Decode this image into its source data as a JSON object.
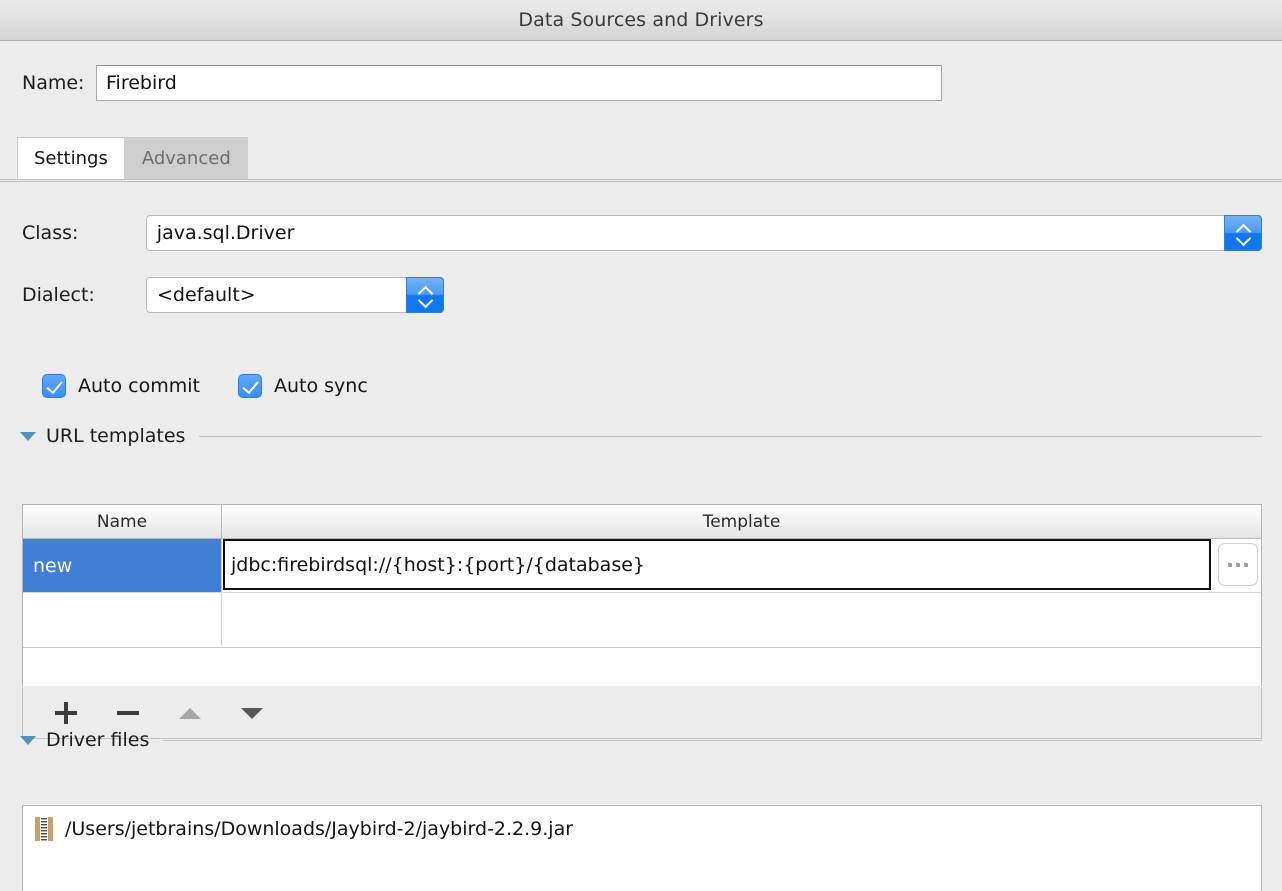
{
  "window": {
    "title": "Data Sources and Drivers"
  },
  "name_field": {
    "label": "Name:",
    "value": "Firebird",
    "placeholder": ""
  },
  "tabs": [
    {
      "label": "Settings",
      "active": true
    },
    {
      "label": "Advanced",
      "active": false
    }
  ],
  "settings": {
    "class": {
      "label": "Class:",
      "value": "java.sql.Driver"
    },
    "dialect": {
      "label": "Dialect:",
      "value": "<default>"
    },
    "checkboxes": [
      {
        "label": "Auto commit",
        "checked": true
      },
      {
        "label": "Auto sync",
        "checked": true
      }
    ]
  },
  "url_templates": {
    "section_title": "URL templates",
    "expanded": true,
    "columns": [
      "Name",
      "Template"
    ],
    "rows": [
      {
        "name": "new",
        "template": "jdbc:firebirdsql://{host}:{port}/{database}",
        "selected": true,
        "editing": true
      },
      {
        "name": "",
        "template": "",
        "selected": false,
        "editing": false
      }
    ],
    "browse_button": "...",
    "toolbar": [
      {
        "name": "add",
        "glyph": "+",
        "enabled": true
      },
      {
        "name": "remove",
        "glyph": "−",
        "enabled": true
      },
      {
        "name": "move-up",
        "glyph": "▲",
        "enabled": false
      },
      {
        "name": "move-down",
        "glyph": "▼",
        "enabled": true
      }
    ]
  },
  "driver_files": {
    "section_title": "Driver files",
    "expanded": true,
    "items": [
      {
        "icon": "jar-archive-icon",
        "path": "/Users/jetbrains/Downloads/Jaybird-2/jaybird-2.2.9.jar"
      }
    ]
  },
  "colors": {
    "selection_blue": "#3f7fd5",
    "accent_blue": "#3d8ef3",
    "section_triangle": "#4f93b8",
    "window_bg": "#ececec",
    "jar_icon": "#c9a06a"
  }
}
